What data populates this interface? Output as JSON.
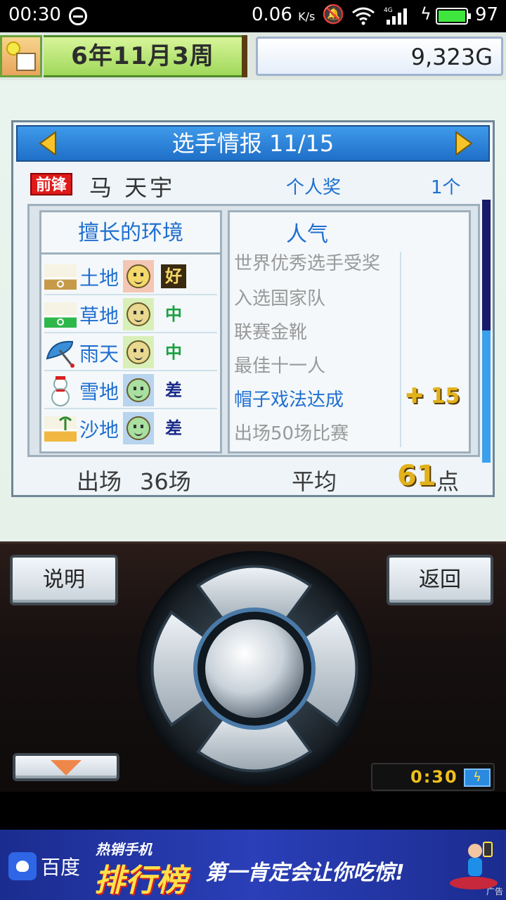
{
  "status_bar": {
    "time": "00:30",
    "net_speed": "0.06",
    "net_unit": "K/s",
    "network_label": "4G",
    "battery": "97"
  },
  "game_bar": {
    "date": "6年11月3周",
    "money": "9,323G"
  },
  "panel": {
    "title": "选手情报 11/15",
    "position": "前锋",
    "player_name": "马 天宇",
    "award_label": "个人奖",
    "award_count": "1个",
    "env_title": "擅长的环境",
    "environments": [
      {
        "label": "土地",
        "grade": "好",
        "icon": "dirt-field-icon",
        "face": "happy"
      },
      {
        "label": "草地",
        "grade": "中",
        "icon": "grass-field-icon",
        "face": "neutral"
      },
      {
        "label": "雨天",
        "grade": "中",
        "icon": "umbrella-icon",
        "face": "neutral"
      },
      {
        "label": "雪地",
        "grade": "差",
        "icon": "snowman-icon",
        "face": "sad"
      },
      {
        "label": "沙地",
        "grade": "差",
        "icon": "beach-icon",
        "face": "sad"
      }
    ],
    "pop_title": "人气",
    "popularity_items": [
      "世界优秀选手受奖",
      "入选国家队",
      "联赛金靴",
      "最佳十一人",
      "帽子戏法达成",
      "出场50场比赛"
    ],
    "pop_bonus": "✚ 15",
    "appearances_label": "出场",
    "appearances_value": "36场",
    "average_label": "平均",
    "average_value": "61",
    "average_unit": "点"
  },
  "controls": {
    "help_label": "说明",
    "back_label": "返回",
    "clock": "0:30"
  },
  "ad": {
    "brand": "百度",
    "hot_line1": "热销手机",
    "hot_line2": "排行榜",
    "slogan": "第一肯定会让你吃惊!",
    "tag": "广告"
  },
  "colors": {
    "header_blue": "#1f6fc8",
    "text_blue": "#1f6fd0",
    "gold": "#e2b21c",
    "badge_red": "#e01a1a"
  }
}
